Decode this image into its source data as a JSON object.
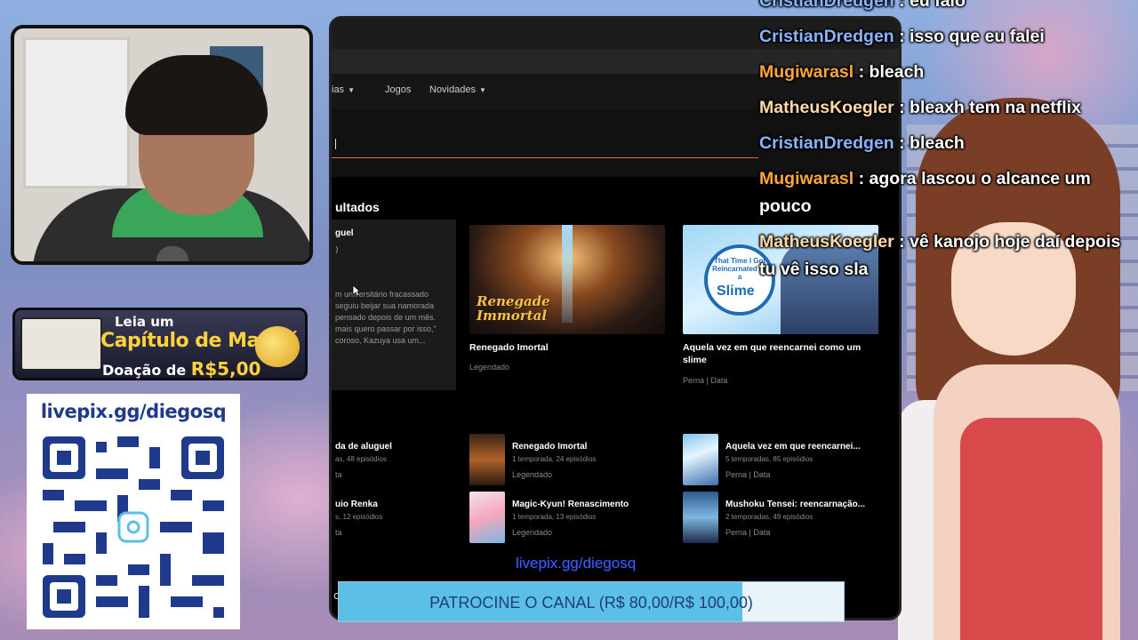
{
  "chat": {
    "messages": [
      {
        "user": "CristianDredgen",
        "color": "blue",
        "text": "eu falo"
      },
      {
        "user": "CristianDredgen",
        "color": "blue",
        "text": "isso que eu falei"
      },
      {
        "user": "Mugiwarasl",
        "color": "orange",
        "text": "bleach"
      },
      {
        "user": "MatheusKoegler",
        "color": "peach",
        "text": "bleaxh tem na netflix"
      },
      {
        "user": "CristianDredgen",
        "color": "blue",
        "text": "bleach"
      },
      {
        "user": "Mugiwarasl",
        "color": "orange",
        "text": "agora lascou o alcance um pouco"
      },
      {
        "user": "MatheusKoegler",
        "color": "peach",
        "text": "vê kanojo hoje daí depois tu vê isso sla"
      }
    ],
    "separator": " : "
  },
  "banner": {
    "line1": "Leia um",
    "line2": "Capítulo de Mangá",
    "line3_prefix": "Doação de",
    "line3_amount": "R$5,00"
  },
  "qr_card": {
    "url": "livepix.gg/diegosq"
  },
  "browser": {
    "menu": {
      "item_partial": "ias",
      "games": "Jogos",
      "news": "Novidades"
    },
    "results_heading": "ultados",
    "featured": {
      "partial_title": "guel",
      "partial_num": ")",
      "partial_desc": "m universitário fracassado\nseguiu beijar sua namorada\npensado depois de um mês.\nmais quero passar por isso,\"\ncoroso, Kazuya usa um..."
    },
    "cards": [
      {
        "title": "Renegado Imortal",
        "sub": "Legendado",
        "logo": "Renegade\nImmortal"
      },
      {
        "title": "Aquela vez em que reencarnei como um slime",
        "sub": "Perna | Data",
        "logo_small": "That Time I Got Reincarnated as a",
        "logo_big": "Slime"
      }
    ],
    "list_left": [
      {
        "title": "da de aluguel",
        "meta": "as, 48 episódios",
        "src": "ta"
      },
      {
        "title": "uio Renka",
        "meta": "s, 12 episódios",
        "src": "ta"
      }
    ],
    "list_mid": [
      {
        "title": "Renegado Imortal",
        "meta": "1 temporada, 24 episódios",
        "src": "Legendado"
      },
      {
        "title": "Magic-Kyun! Renascimento",
        "meta": "1 temporada, 13 episódios",
        "src": "Legendado"
      }
    ],
    "list_right": [
      {
        "title": "Aquela vez em que reencarnei...",
        "meta": "5 temporadas, 85 episódios",
        "src": "Perna | Data"
      },
      {
        "title": "Mushoku Tensei: reencarnação...",
        "meta": "2 temporadas, 49 episódios",
        "src": "Perna | Data"
      }
    ]
  },
  "overlay": {
    "pix_url": "livepix.gg/diegosq",
    "goal_label": "PATROCINE O CANAL (R$ 80,00/R$ 100,00)",
    "goal_current": 80,
    "goal_target": 100,
    "stub": "ca"
  },
  "colors": {
    "chat_blue": "#8ab4ff",
    "chat_orange": "#ffa53a",
    "chat_peach": "#ffd9a8",
    "accent_orange": "#e0722b",
    "goal_fill": "#5cc0e6"
  }
}
